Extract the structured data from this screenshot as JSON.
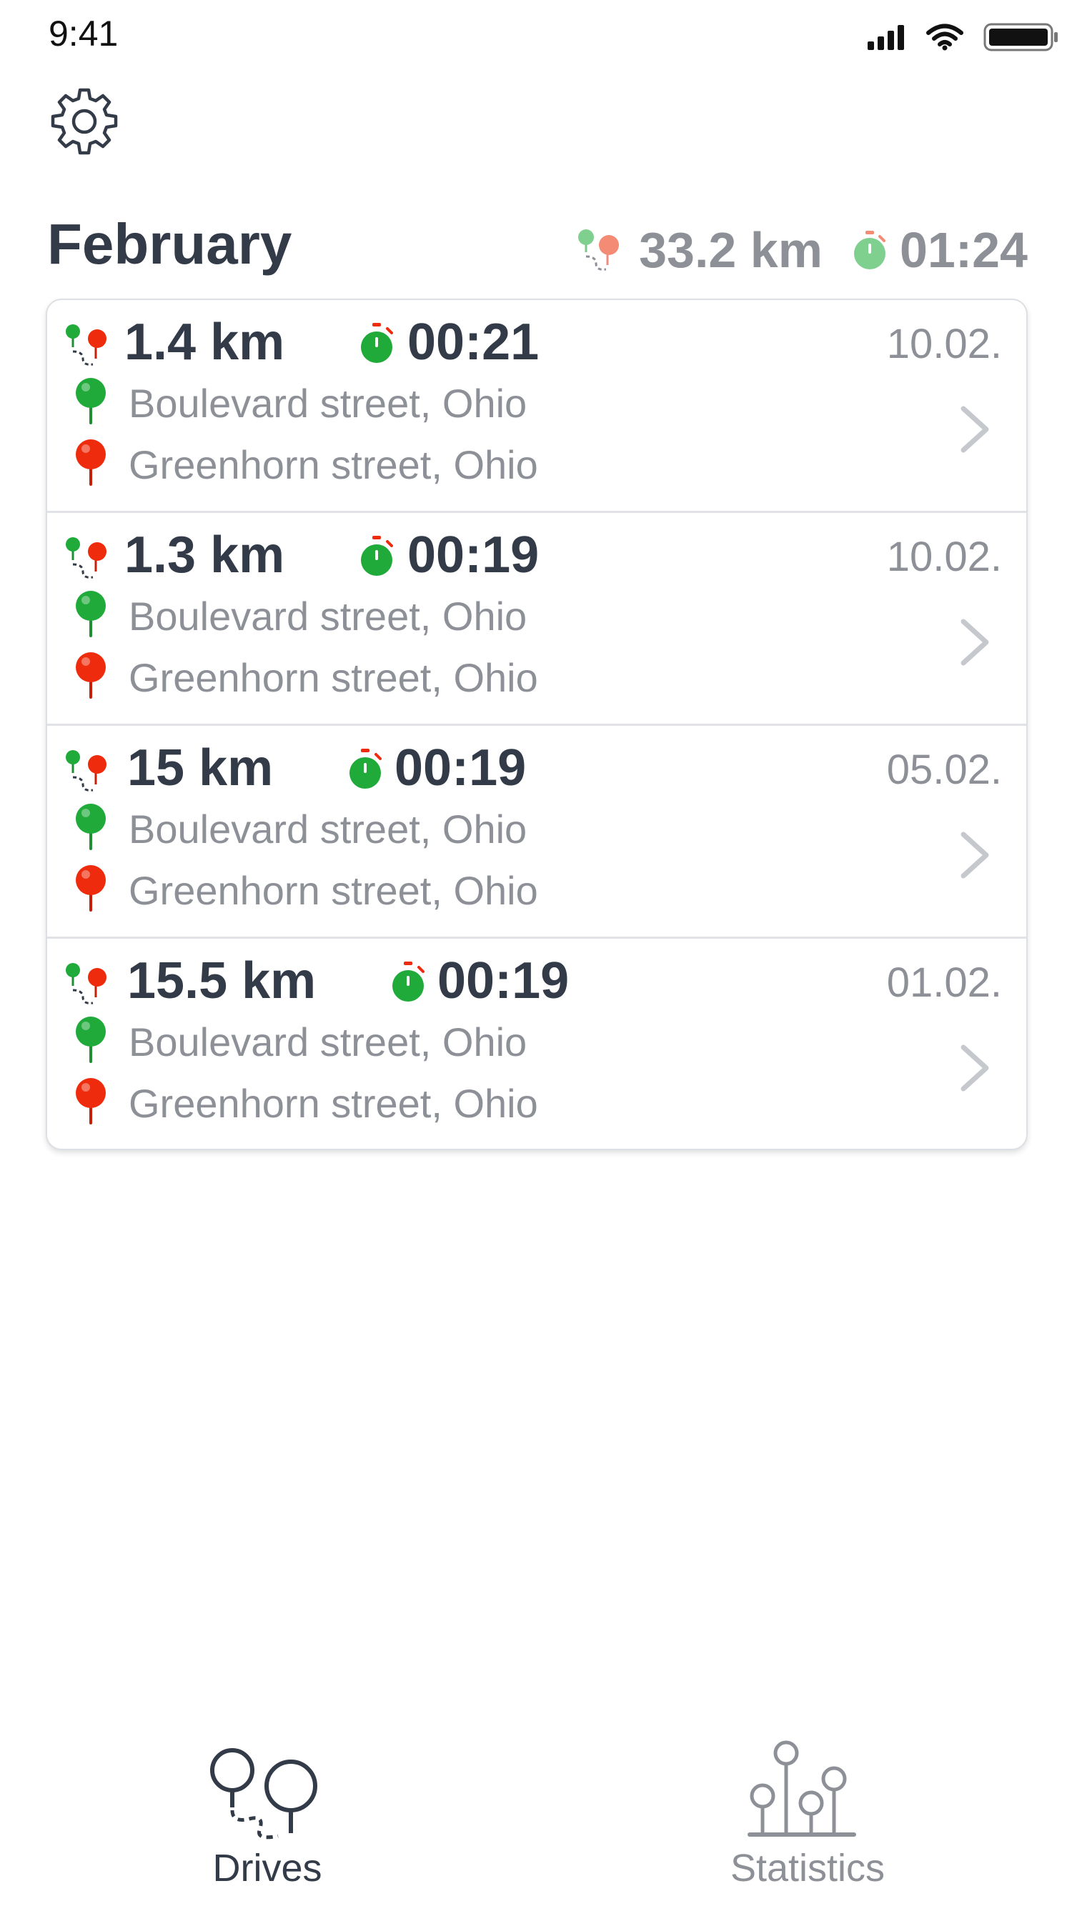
{
  "status_bar": {
    "time": "9:41"
  },
  "header": {
    "month": "February",
    "total_distance": "33.2 km",
    "total_duration": "01:24"
  },
  "drives": [
    {
      "distance": "1.4 km",
      "duration": "00:21",
      "date": "10.02.",
      "start": "Boulevard street, Ohio",
      "end": "Greenhorn street, Ohio"
    },
    {
      "distance": "1.3 km",
      "duration": "00:19",
      "date": "10.02.",
      "start": "Boulevard street, Ohio",
      "end": "Greenhorn street, Ohio"
    },
    {
      "distance": "15 km",
      "duration": "00:19",
      "date": "05.02.",
      "start": "Boulevard street, Ohio",
      "end": "Greenhorn street, Ohio"
    },
    {
      "distance": "15.5 km",
      "duration": "00:19",
      "date": "01.02.",
      "start": "Boulevard street, Ohio",
      "end": "Greenhorn street, Ohio"
    }
  ],
  "tabs": [
    {
      "label": "Drives",
      "active": true
    },
    {
      "label": "Statistics",
      "active": false
    }
  ],
  "colors": {
    "text_dark": "#333b48",
    "text_muted": "#8d9097",
    "start_pin": "#1faa3a",
    "end_pin": "#ee2b0c",
    "tab_active": "#333b48",
    "tab_inactive": "#8d9097"
  },
  "icons": {
    "settings": "gear-icon",
    "route": "route-icon",
    "duration": "stopwatch-icon",
    "start": "green-pin-icon",
    "end": "red-pin-icon",
    "row_action": "chevron-right-icon",
    "tab_drives": "drives-route-icon",
    "tab_statistics": "statistics-pins-icon"
  }
}
